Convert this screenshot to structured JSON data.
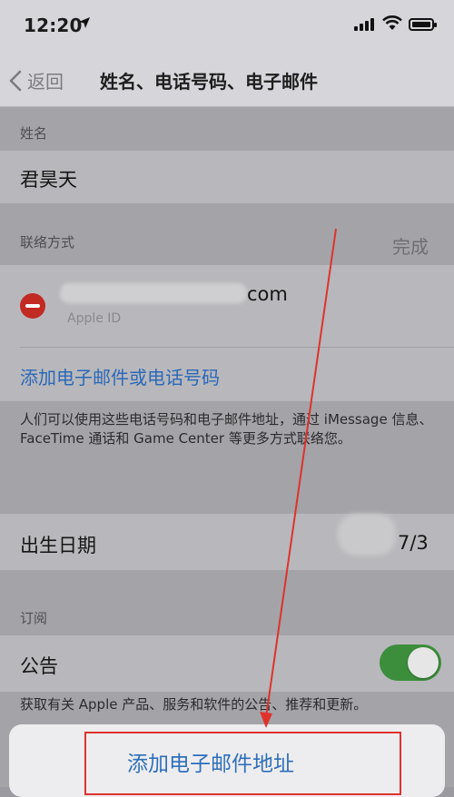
{
  "status_bar": {
    "time": "12:20"
  },
  "nav": {
    "back_label": "返回",
    "title": "姓名、电话号码、电子邮件"
  },
  "name_section": {
    "label": "姓名",
    "value": "君昊天"
  },
  "contact_section": {
    "label": "联络方式",
    "done_label": "完成",
    "email_suffix": "com",
    "email_type": "Apple ID",
    "add_link": "添加电子邮件或电话号码",
    "footer": "人们可以使用这些电话号码和电子邮件地址，通过 iMessage 信息、FaceTime 通话和 Game Center 等更多方式联络您。"
  },
  "birthday": {
    "label": "出生日期",
    "value": "7/3"
  },
  "subscription_section": {
    "label": "订阅",
    "item_label": "公告",
    "toggle_on": true,
    "footer": "获取有关 Apple 产品、服务和软件的公告、推荐和更新。"
  },
  "action_sheet": {
    "button": "添加电子邮件地址"
  },
  "colors": {
    "link": "#2b68b8",
    "delete": "#c22a24",
    "toggle_on": "#3c8e3c",
    "annotation": "#e0322c"
  }
}
